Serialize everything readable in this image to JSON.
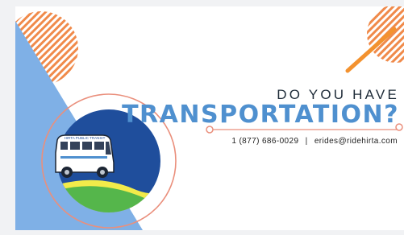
{
  "headline": {
    "line1": "DO YOU HAVE",
    "line2": "TRANSPORTATION?"
  },
  "contact": {
    "phone": "1 (877) 686-0029",
    "separator": "|",
    "email": "erides@ridehirta.com"
  },
  "bus_sign": "HIRTA PUBLIC TRANSIT",
  "colors": {
    "triangle_blue": "#7fb0e6",
    "circle_navy": "#1f4e9c",
    "hill_green": "#55b64b",
    "swoosh_yellow": "#f2eb4a",
    "accent_orange": "#f08a4a",
    "ring_salmon": "#ea8f7c",
    "headline_blue": "#4f90cf"
  }
}
